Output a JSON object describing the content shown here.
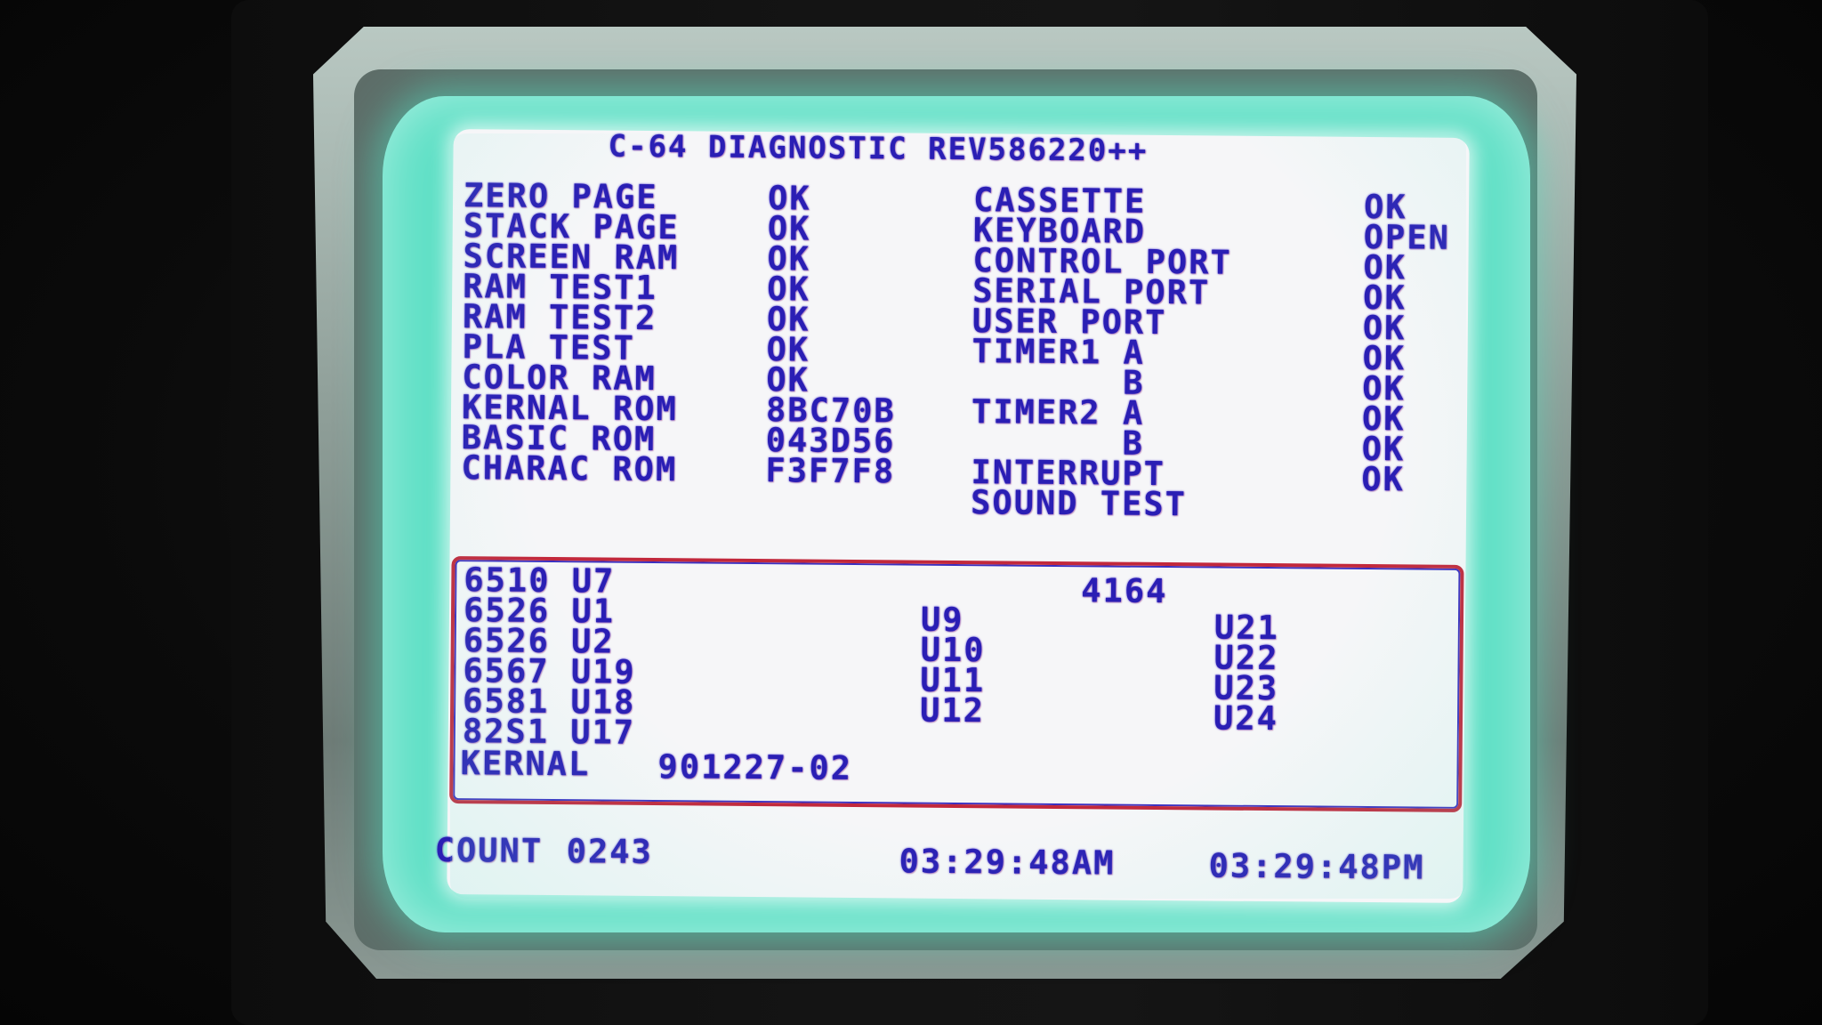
{
  "title": "C-64 DIAGNOSTIC REV586220++",
  "tests_left": [
    {
      "name": "ZERO PAGE",
      "result": "OK"
    },
    {
      "name": "STACK PAGE",
      "result": "OK"
    },
    {
      "name": "SCREEN RAM",
      "result": "OK"
    },
    {
      "name": "RAM TEST1",
      "result": "OK"
    },
    {
      "name": "RAM TEST2",
      "result": "OK"
    },
    {
      "name": "PLA TEST",
      "result": "OK"
    },
    {
      "name": "COLOR RAM",
      "result": "OK"
    },
    {
      "name": "KERNAL ROM",
      "result": "8BC70B"
    },
    {
      "name": "BASIC ROM",
      "result": "043D56"
    },
    {
      "name": "CHARAC ROM",
      "result": "F3F7F8"
    }
  ],
  "tests_right": [
    {
      "name": "CASSETTE",
      "result": "OK"
    },
    {
      "name": "KEYBOARD",
      "result": "OPEN"
    },
    {
      "name": "CONTROL PORT",
      "result": "OK"
    },
    {
      "name": "SERIAL PORT",
      "result": "OK"
    },
    {
      "name": "USER PORT",
      "result": "OK"
    },
    {
      "name": "TIMER1 A",
      "result": "OK"
    },
    {
      "name": "       B",
      "result": "OK"
    },
    {
      "name": "TIMER2 A",
      "result": "OK"
    },
    {
      "name": "       B",
      "result": "OK"
    },
    {
      "name": "INTERRUPT",
      "result": "OK"
    },
    {
      "name": "SOUND TEST",
      "result": ""
    }
  ],
  "chips_left": [
    "6510 U7",
    "6526 U1",
    "6526 U2",
    "6567 U19",
    "6581 U18",
    "82S1 U17"
  ],
  "ram_header": "4164",
  "ram_chips_a": [
    "U9",
    "U10",
    "U11",
    "U12"
  ],
  "ram_chips_b": [
    "U21",
    "U22",
    "U23",
    "U24"
  ],
  "kernal_label": "KERNAL",
  "kernal_version": "901227-02",
  "count_label": "COUNT",
  "count_value": "0243",
  "time_am": "03:29:48AM",
  "time_pm": "03:29:48PM"
}
